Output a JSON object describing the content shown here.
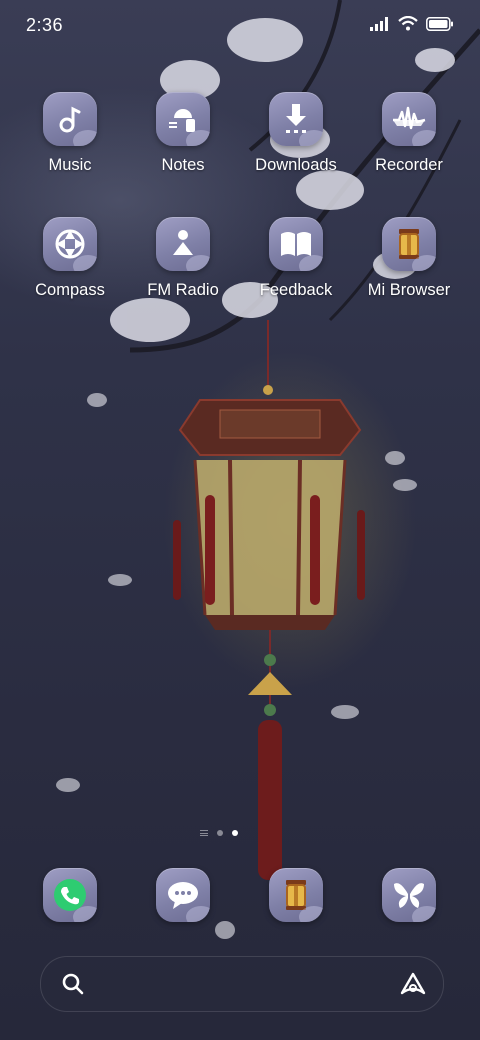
{
  "status_bar": {
    "time": "2:36"
  },
  "apps": [
    {
      "label": "Music",
      "icon": "music-note-icon"
    },
    {
      "label": "Notes",
      "icon": "notes-icon"
    },
    {
      "label": "Downloads",
      "icon": "download-icon"
    },
    {
      "label": "Recorder",
      "icon": "waveform-icon"
    },
    {
      "label": "Compass",
      "icon": "compass-icon"
    },
    {
      "label": "FM Radio",
      "icon": "radio-icon"
    },
    {
      "label": "Feedback",
      "icon": "book-icon"
    },
    {
      "label": "Mi Browser",
      "icon": "lantern-icon"
    }
  ],
  "dock": [
    {
      "icon": "phone-icon"
    },
    {
      "icon": "message-bubble-icon"
    },
    {
      "icon": "lantern-icon"
    },
    {
      "icon": "butterfly-icon"
    }
  ],
  "page_indicator": {
    "pages": 2,
    "current": 2
  },
  "accent_colors": {
    "phone_green": "#2ecc71",
    "lantern_gold": "#e6b84a"
  }
}
